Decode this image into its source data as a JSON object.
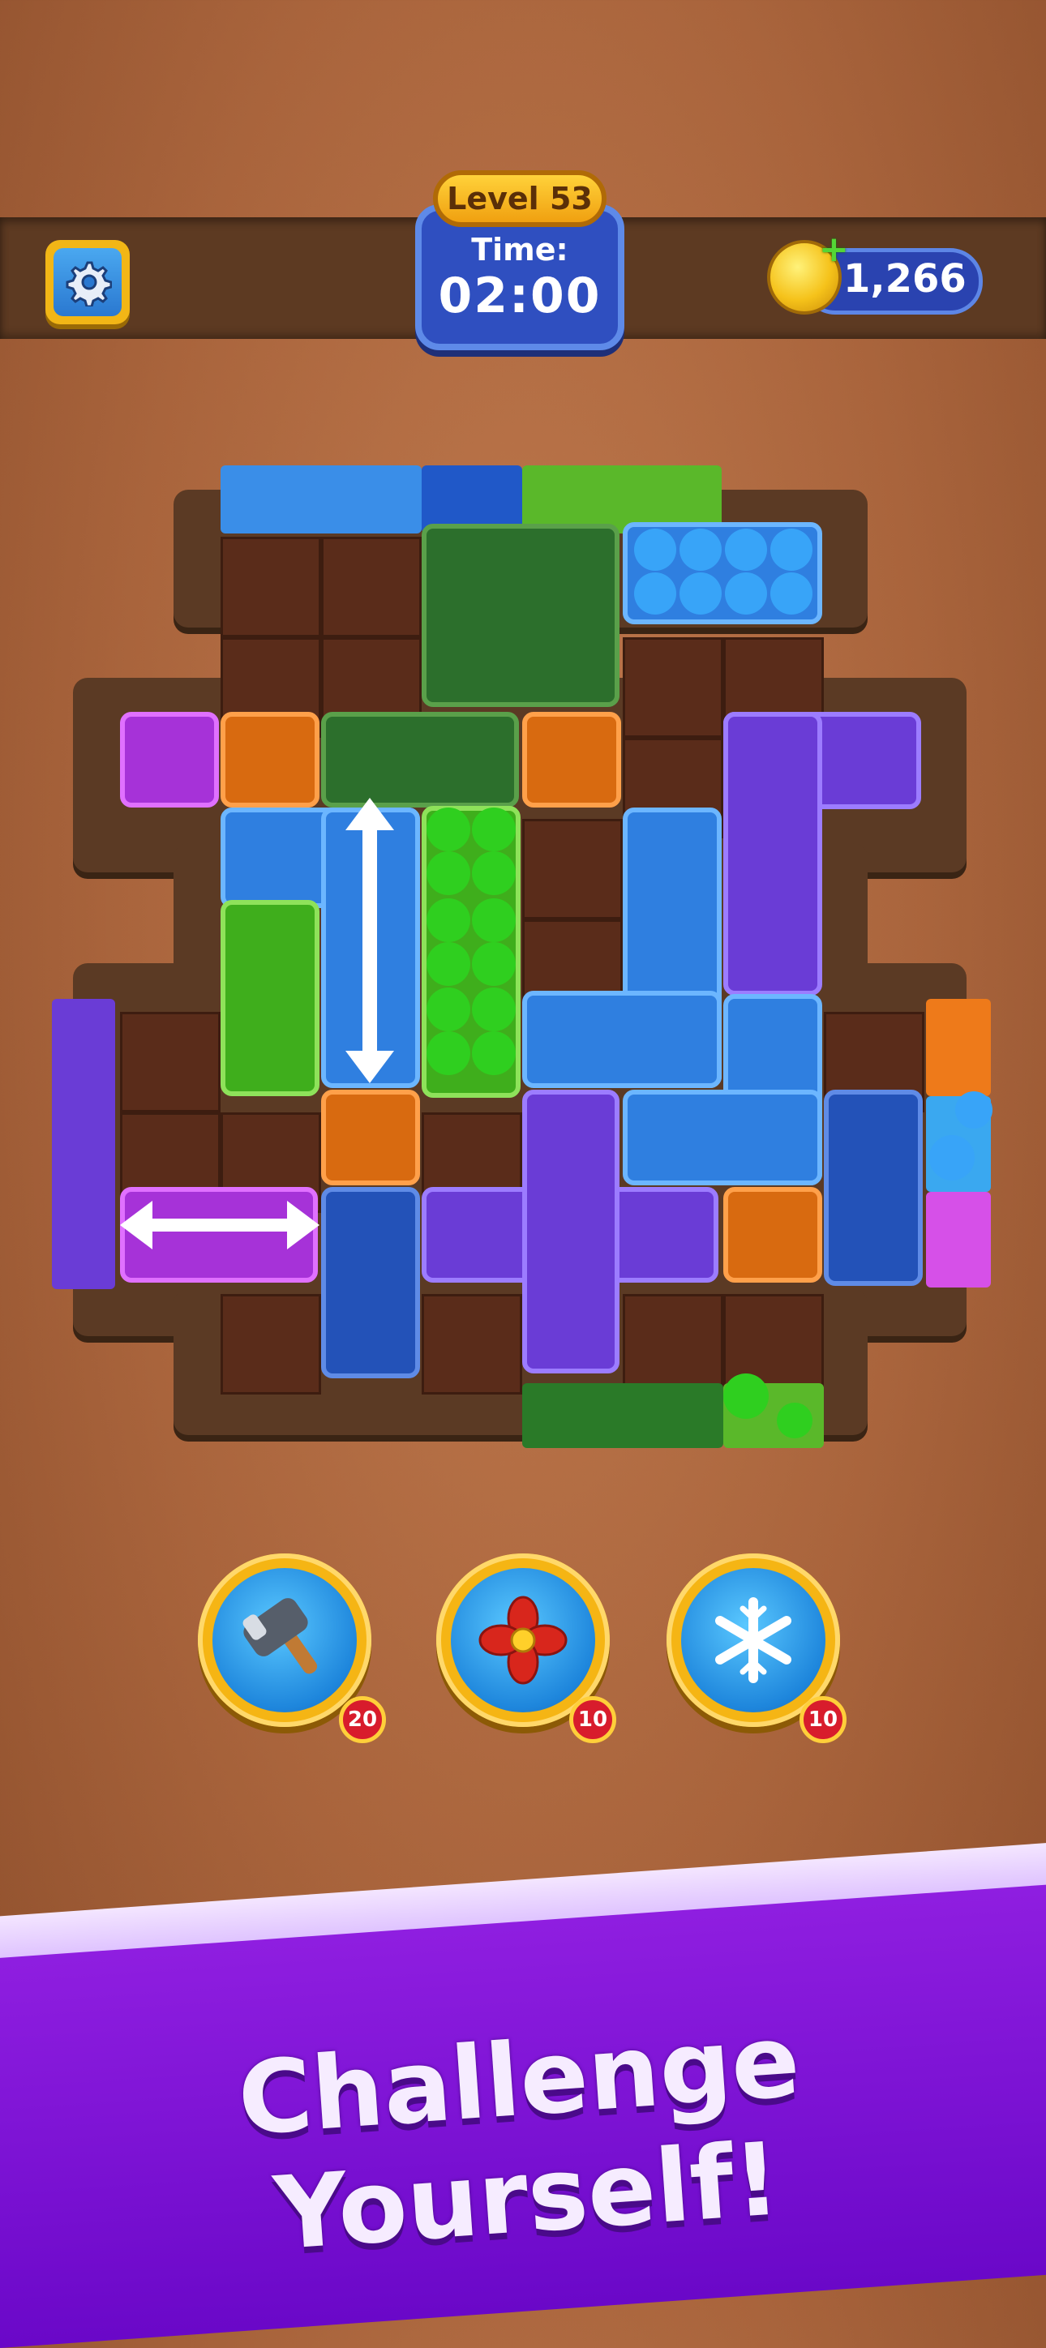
{
  "hud": {
    "level_label": "Level 53",
    "time_label": "Time:",
    "time_value": "02:00",
    "coins": "1,266",
    "coin_plus": "+"
  },
  "powerups": [
    {
      "name": "hammer",
      "icon": "hammer-icon",
      "count": "20"
    },
    {
      "name": "fan",
      "icon": "fan-icon",
      "count": "10"
    },
    {
      "name": "freeze",
      "icon": "snowflake-icon",
      "count": "10"
    }
  ],
  "banner": {
    "text": "Challenge Yourself!"
  },
  "colors": {
    "blue": "#2f7fe0",
    "purple": "#6a3cd6",
    "green": "#2c6f2c",
    "light_green": "#3fae1c",
    "orange": "#d86a10",
    "magenta": "#a632d8"
  }
}
